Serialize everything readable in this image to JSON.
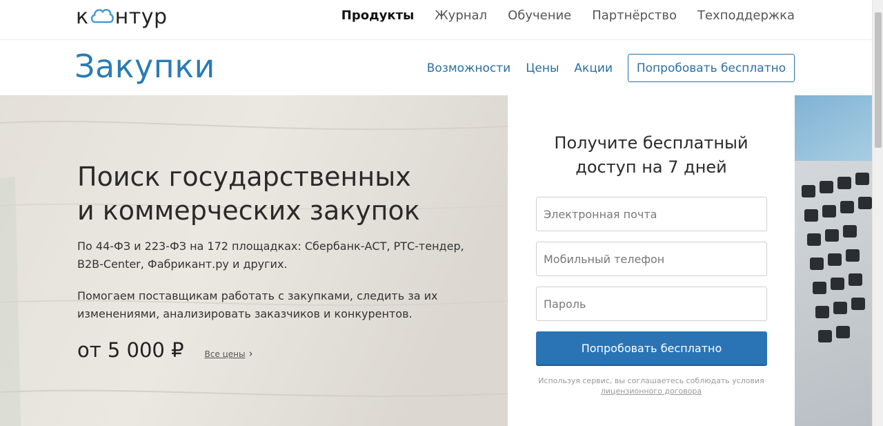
{
  "header": {
    "logo_text_left": "к",
    "logo_text_right": "нтур",
    "nav": [
      "Продукты",
      "Журнал",
      "Обучение",
      "Партнёрство",
      "Техподдержка"
    ]
  },
  "product": {
    "title": "Закупки",
    "nav": [
      "Возможности",
      "Цены",
      "Акции"
    ],
    "try_label": "Попробовать бесплатно"
  },
  "hero": {
    "heading_line1": "Поиск государственных",
    "heading_line2": "и коммерческих закупок",
    "paragraph1": "По 44-ФЗ и 223-ФЗ на 172 площадках: Сбербанк-АСТ, РТС-тендер, B2B-Center, Фабрикант.ру и других.",
    "paragraph2": "Помогаем поставщикам работать с закупками, следить за их изменениями, анализировать заказчиков и конкурентов.",
    "price": "от 5 000 ₽",
    "price_link": "Все цены",
    "price_chevron": "›"
  },
  "form": {
    "title_line1": "Получите бесплатный",
    "title_line2": "доступ на 7 дней",
    "email_placeholder": "Электронная почта",
    "phone_placeholder": "Мобильный телефон",
    "password_placeholder": "Пароль",
    "submit_label": "Попробовать бесплатно",
    "terms_text": "Используя сервис, вы соглашаетесь соблюдать условия",
    "terms_link": "лицензионного договора"
  },
  "colors": {
    "brand_blue": "#2a7bb5",
    "button_blue": "#2a74b5",
    "logo_cloud": "#4a9ad0"
  }
}
